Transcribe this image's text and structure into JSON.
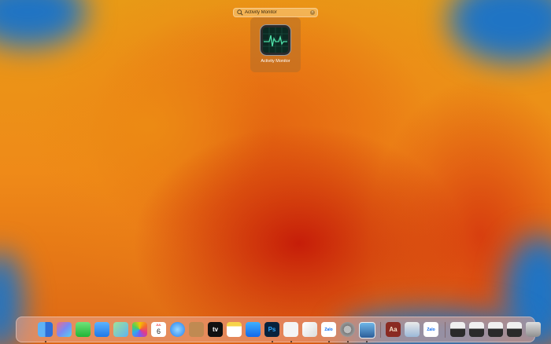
{
  "spotlight": {
    "query": "Activity Monitor",
    "results": [
      {
        "label": "Activity Monitor",
        "icon": "activity-monitor-icon"
      }
    ]
  },
  "dock": {
    "apps": [
      {
        "name": "finder-icon",
        "running": true
      },
      {
        "name": "launchpad-icon",
        "running": false
      },
      {
        "name": "messages-icon",
        "running": false
      },
      {
        "name": "mail-icon",
        "running": false
      },
      {
        "name": "maps-icon",
        "running": false
      },
      {
        "name": "photos-icon",
        "running": false
      },
      {
        "name": "calendar-icon",
        "running": false,
        "month": "JUL",
        "day": "6"
      },
      {
        "name": "safari-icon",
        "running": false
      },
      {
        "name": "contacts-icon",
        "running": false
      },
      {
        "name": "apple-tv-icon",
        "running": false,
        "text": "tv"
      },
      {
        "name": "notes-icon",
        "running": false
      },
      {
        "name": "app-store-icon",
        "running": false
      },
      {
        "name": "photoshop-icon",
        "running": true,
        "text": "Ps"
      },
      {
        "name": "spinning-app-icon",
        "running": true
      },
      {
        "name": "textedit-icon",
        "running": false
      },
      {
        "name": "zalo-icon",
        "running": true,
        "text": "Zalo"
      },
      {
        "name": "system-settings-icon",
        "running": true
      },
      {
        "name": "preview-icon",
        "running": true
      },
      {
        "name": "dictionary-icon",
        "running": false,
        "text": "Aa"
      },
      {
        "name": "screenshot-folder-icon",
        "running": false
      },
      {
        "name": "zalo-download-icon",
        "running": false,
        "text": "Zalo"
      },
      {
        "name": "window-preview-icon",
        "running": false
      },
      {
        "name": "window-preview-icon",
        "running": false
      },
      {
        "name": "window-preview-icon",
        "running": false
      },
      {
        "name": "window-preview-icon",
        "running": false
      },
      {
        "name": "trash-icon",
        "running": false
      }
    ]
  },
  "colors": {
    "wallpaper_blue": "#1f74c4",
    "wallpaper_orange": "#ef8a18",
    "wallpaper_red": "#c41808"
  }
}
